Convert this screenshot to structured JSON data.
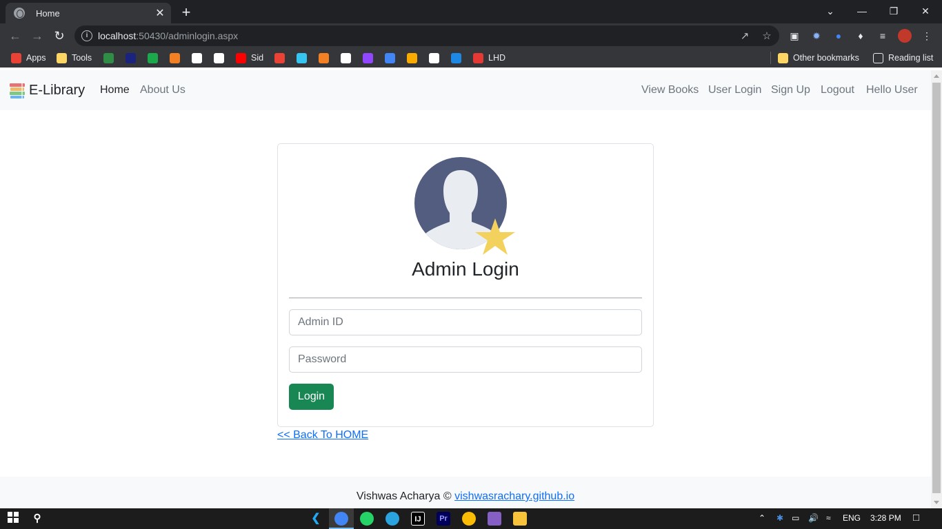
{
  "browser": {
    "tab_title": "Home",
    "tab_close": "✕",
    "new_tab": "+",
    "url_host": "localhost",
    "url_path": ":50430/adminlogin.aspx",
    "window_controls": [
      "⌄",
      "—",
      "❐",
      "✕"
    ],
    "bookmarks": [
      {
        "label": "Apps",
        "icon": "apps-grid-icon",
        "color": "#ea4335"
      },
      {
        "label": "Tools",
        "icon": "folder-icon",
        "color": "#fdd663"
      },
      {
        "label": "",
        "icon": "geeksforgeeks-icon",
        "color": "#2f8d46"
      },
      {
        "label": "",
        "icon": "bookmark-icon",
        "color": "#1a237e"
      },
      {
        "label": "",
        "icon": "hackerrank-icon",
        "color": "#1ba94c"
      },
      {
        "label": "",
        "icon": "stackoverflow-icon",
        "color": "#f48024"
      },
      {
        "label": "",
        "icon": "victory-icon",
        "color": "#ffffff"
      },
      {
        "label": "",
        "icon": "github-icon",
        "color": "#ffffff"
      },
      {
        "label": "Sid",
        "icon": "youtube-icon",
        "color": "#ff0000"
      },
      {
        "label": "",
        "icon": "gmail-icon",
        "color": "#ea4335"
      },
      {
        "label": "",
        "icon": "slack-icon",
        "color": "#36c5f0"
      },
      {
        "label": "",
        "icon": "stack-icon",
        "color": "#f48024"
      },
      {
        "label": "",
        "icon": "shield-icon",
        "color": "#ffffff"
      },
      {
        "label": "",
        "icon": "twitch-icon",
        "color": "#9146ff"
      },
      {
        "label": "",
        "icon": "circle-app-icon",
        "color": "#4285f4"
      },
      {
        "label": "",
        "icon": "coin-icon",
        "color": "#f9ab00"
      },
      {
        "label": "",
        "icon": "lock-icon",
        "color": "#ffffff"
      },
      {
        "label": "",
        "icon": "wave-icon",
        "color": "#1e88e5"
      },
      {
        "label": "LHD",
        "icon": "hammer-icon",
        "color": "#e53935"
      }
    ],
    "other_bookmarks": "Other bookmarks",
    "reading_list": "Reading list"
  },
  "site": {
    "brand": "E-Library",
    "nav_left": [
      "Home",
      "About Us"
    ],
    "nav_right": [
      "View Books",
      "User Login",
      "Sign Up",
      "Logout",
      "Hello User"
    ]
  },
  "login": {
    "title": "Admin Login",
    "admin_id_placeholder": "Admin ID",
    "password_placeholder": "Password",
    "button_label": "Login"
  },
  "back_link": "<< Back To HOME",
  "footer": {
    "author": "Vishwas Acharya ©",
    "link_text": "vishwasrachary.github.io"
  },
  "taskbar": {
    "language": "ENG",
    "time": "3:28 PM"
  },
  "colors": {
    "accent_green": "#198754",
    "link_blue": "#0d6efd",
    "avatar_blue": "#535d80",
    "star_yellow": "#f2d15c"
  }
}
